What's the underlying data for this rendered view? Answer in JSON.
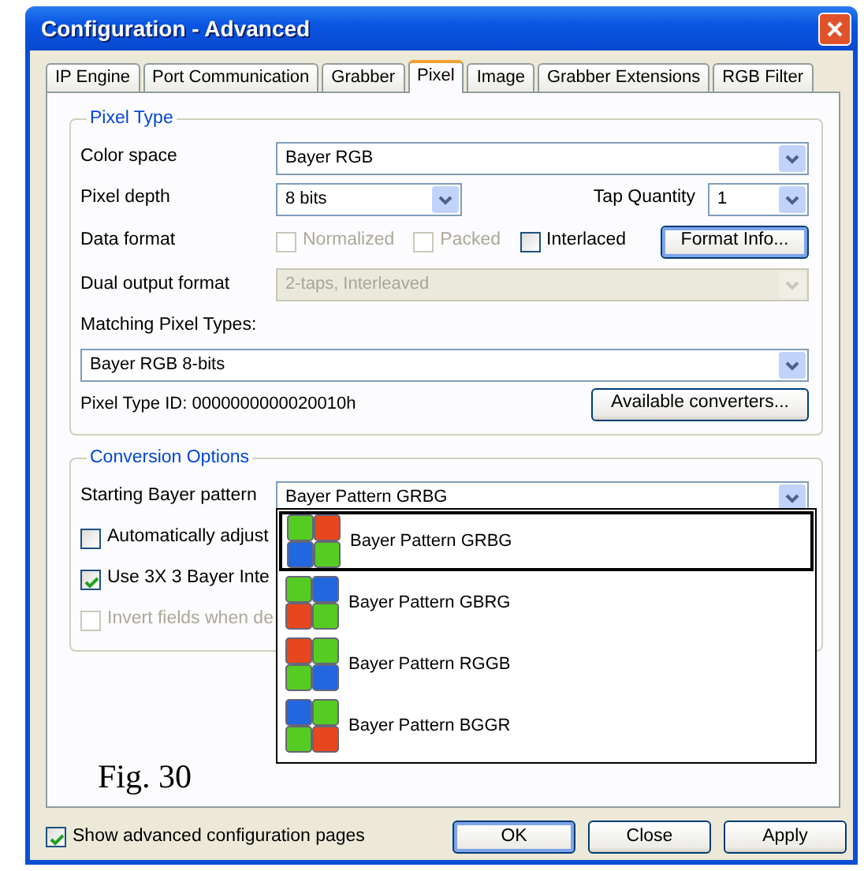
{
  "window": {
    "title": "Configuration - Advanced"
  },
  "tabs": [
    {
      "label": "IP Engine",
      "selected": false
    },
    {
      "label": "Port Communication",
      "selected": false
    },
    {
      "label": "Grabber",
      "selected": false
    },
    {
      "label": "Pixel",
      "selected": true
    },
    {
      "label": "Image",
      "selected": false
    },
    {
      "label": "Grabber Extensions",
      "selected": false
    },
    {
      "label": "RGB Filter",
      "selected": false
    }
  ],
  "pixel_type": {
    "legend": "Pixel Type",
    "color_space": {
      "label": "Color space",
      "value": "Bayer RGB"
    },
    "pixel_depth": {
      "label": "Pixel depth",
      "value": "8 bits"
    },
    "tap_quantity": {
      "label": "Tap Quantity",
      "value": "1"
    },
    "data_format": {
      "label": "Data format",
      "options": [
        {
          "label": "Normalized",
          "checked": false,
          "disabled": true
        },
        {
          "label": "Packed",
          "checked": false,
          "disabled": true
        },
        {
          "label": "Interlaced",
          "checked": false,
          "disabled": false
        }
      ],
      "button": "Format Info..."
    },
    "dual_output": {
      "label": "Dual output format",
      "value": "2-taps, Interleaved",
      "disabled": true
    },
    "matching_label": "Matching Pixel Types:",
    "matching_value": "Bayer RGB 8-bits",
    "pixel_type_id": "Pixel Type ID: 0000000000020010h",
    "converters_button": "Available converters..."
  },
  "conversion": {
    "legend": "Conversion Options",
    "starting_pattern": {
      "label": "Starting Bayer pattern",
      "value": "Bayer Pattern GRBG"
    },
    "options": [
      {
        "label": "Automatically adjust",
        "checked": false,
        "disabled": false
      },
      {
        "label": "Use 3X 3 Bayer Inte",
        "checked": true,
        "disabled": false
      },
      {
        "label": "Invert fields when de",
        "checked": false,
        "disabled": true
      }
    ]
  },
  "dropdown": {
    "items": [
      {
        "label": "Bayer Pattern GRBG",
        "pattern": [
          {
            "color": "#55cc22"
          },
          {
            "color": "#e8461e"
          },
          {
            "color": "#2266e0"
          },
          {
            "color": "#55cc22"
          }
        ],
        "selected": true
      },
      {
        "label": "Bayer Pattern GBRG",
        "pattern": [
          {
            "color": "#55cc22"
          },
          {
            "color": "#2266e0"
          },
          {
            "color": "#e8461e"
          },
          {
            "color": "#55cc22"
          }
        ],
        "selected": false
      },
      {
        "label": "Bayer Pattern RGGB",
        "pattern": [
          {
            "color": "#e8461e"
          },
          {
            "color": "#55cc22"
          },
          {
            "color": "#55cc22"
          },
          {
            "color": "#2266e0"
          }
        ],
        "selected": false
      },
      {
        "label": "Bayer Pattern BGGR",
        "pattern": [
          {
            "color": "#2266e0"
          },
          {
            "color": "#55cc22"
          },
          {
            "color": "#55cc22"
          },
          {
            "color": "#e8461e"
          }
        ],
        "selected": false
      }
    ]
  },
  "caption": "Fig. 30",
  "footer": {
    "show_advanced": {
      "label": "Show advanced configuration pages",
      "checked": true
    },
    "buttons": [
      {
        "label": "OK",
        "default": true
      },
      {
        "label": "Close",
        "default": false
      },
      {
        "label": "Apply",
        "default": false
      }
    ]
  }
}
